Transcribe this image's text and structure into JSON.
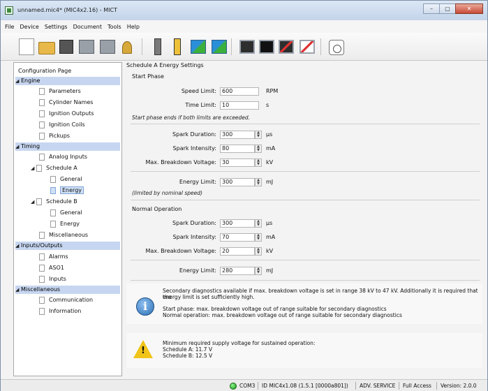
{
  "window": {
    "title": "unnamed.mic4* (MIC4x2.16) - MICT",
    "controls": {
      "minimize": "–",
      "maximize": "▢",
      "close": "✕"
    }
  },
  "menu": [
    "File",
    "Device",
    "Settings",
    "Document",
    "Tools",
    "Help"
  ],
  "toolbar": {
    "icons": [
      "new-document-icon",
      "open-folder-icon",
      "save-icon",
      "device-icon",
      "device-network-icon",
      "key-icon",
      "chip-gray-icon",
      "chip-yellow-icon",
      "upload-arrows-icon",
      "download-arrows-icon",
      "screen-icon",
      "monitor-icon",
      "graph-dark-icon",
      "graph-white-icon",
      "clock-icon"
    ]
  },
  "tree": {
    "title": "Configuration Page",
    "engine": {
      "label": "Engine",
      "items": [
        "Parameters",
        "Cylinder Names",
        "Ignition Outputs",
        "Ignition Coils",
        "Pickups"
      ]
    },
    "timing": {
      "label": "Timing",
      "analog": "Analog Inputs",
      "schedule_a": {
        "label": "Schedule A",
        "items": [
          "General",
          "Energy"
        ]
      },
      "schedule_b": {
        "label": "Schedule B",
        "items": [
          "General",
          "Energy"
        ]
      },
      "misc": "Miscellaneous"
    },
    "io": {
      "label": "Inputs/Outputs",
      "items": [
        "Alarms",
        "ASO1",
        "Inputs"
      ]
    },
    "misc": {
      "label": "Miscellaneous",
      "items": [
        "Communication",
        "Information"
      ]
    }
  },
  "content": {
    "heading": "Schedule A Energy Settings",
    "start_phase": {
      "title": "Start Phase",
      "speed_limit": {
        "label": "Speed Limit:",
        "value": "600",
        "unit": "RPM"
      },
      "time_limit": {
        "label": "Time Limit:",
        "value": "10",
        "unit": "s"
      },
      "note": "Start phase ends if both limits are exceeded.",
      "spark_duration": {
        "label": "Spark Duration:",
        "value": "300",
        "unit": "µs"
      },
      "spark_intensity": {
        "label": "Spark Intensity:",
        "value": "80",
        "unit": "mA"
      },
      "breakdown_voltage": {
        "label": "Max. Breakdown Voltage:",
        "value": "30",
        "unit": "kV"
      },
      "energy_limit": {
        "label": "Energy Limit:",
        "value": "300",
        "unit": "mJ"
      },
      "energy_note": "(limited by nominal speed)"
    },
    "normal": {
      "title": "Normal Operation",
      "spark_duration": {
        "label": "Spark Duration:",
        "value": "300",
        "unit": "µs"
      },
      "spark_intensity": {
        "label": "Spark Intensity:",
        "value": "70",
        "unit": "mA"
      },
      "breakdown_voltage": {
        "label": "Max. Breakdown Voltage:",
        "value": "20",
        "unit": "kV"
      },
      "energy_limit": {
        "label": "Energy Limit:",
        "value": "280",
        "unit": "mJ"
      }
    },
    "info": {
      "line1": "Secondary diagnostics available if max. breakdown voltage is set in range 38 kV to 47 kV. Additionally it is required that the",
      "line2": "energy limit is set sufficiently high.",
      "line3": "Start phase: max. breakdown voltage out of range suitable for secondary diagnostics",
      "line4": "Normal operation: max. breakdown voltage out of range suitable for secondary diagnostics"
    },
    "warning": {
      "line1": "Minimum required supply voltage for sustained operation:",
      "line2": "Schedule A: 11.7 V",
      "line3": "Schedule B: 12.5 V"
    }
  },
  "status": {
    "port": "COM3",
    "device": "ID MIC4x1.08 (1.5.1 [0000a801])",
    "service": "ADV. SERVICE",
    "access": "Full Access",
    "version": "Version: 2.0.0"
  }
}
